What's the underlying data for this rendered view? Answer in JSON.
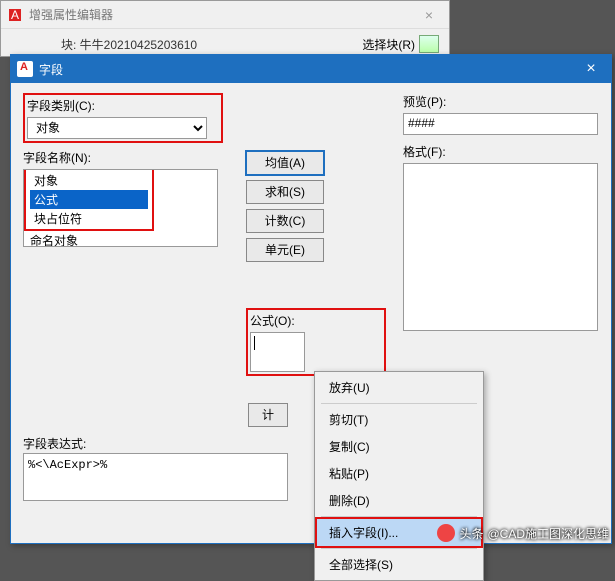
{
  "back_window": {
    "title": "增强属性编辑器",
    "block_line": "块: 牛牛20210425203610",
    "select_label": "选择块(R)"
  },
  "dialog": {
    "title": "字段",
    "category_label": "字段类别(C):",
    "category_value": "对象",
    "names_label": "字段名称(N):",
    "names_items": [
      "对象",
      "公式",
      "块占位符",
      "命名对象"
    ],
    "preview_label": "预览(P):",
    "preview_value": "####",
    "format_label": "格式(F):",
    "buttons": {
      "avg": "均值(A)",
      "sum": "求和(S)",
      "count": "计数(C)",
      "cell": "单元(E)"
    },
    "formula_label": "公式(O):",
    "calc": "计",
    "expr_label": "字段表达式:",
    "expr_value": "%<\\AcExpr>%"
  },
  "context_menu": {
    "items": {
      "undo": "放弃(U)",
      "cut": "剪切(T)",
      "copy": "复制(C)",
      "paste": "粘贴(P)",
      "delete": "删除(D)",
      "insert_field": "插入字段(I)...",
      "select_all": "全部选择(S)"
    }
  },
  "watermark": {
    "prefix": "头条",
    "text": "@CAD施工图深化思维"
  }
}
